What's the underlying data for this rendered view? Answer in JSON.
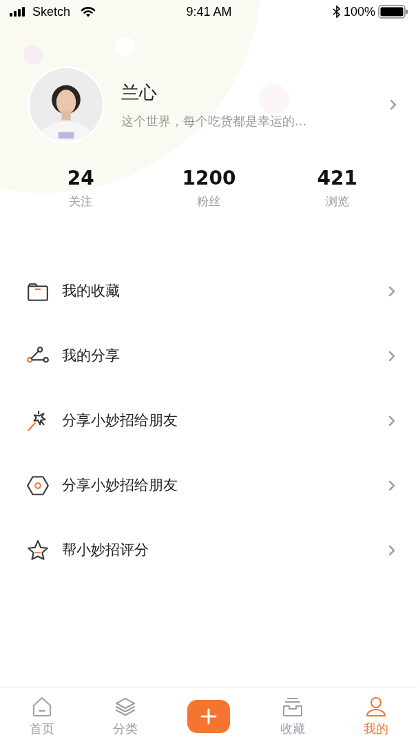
{
  "status_bar": {
    "carrier": "Sketch",
    "time": "9:41 AM",
    "battery": "100%"
  },
  "profile": {
    "name": "兰心",
    "bio": "这个世界，每个吃货都是幸运的..."
  },
  "stats": [
    {
      "value": "24",
      "label": "关注"
    },
    {
      "value": "1200",
      "label": "粉丝"
    },
    {
      "value": "421",
      "label": "浏览"
    }
  ],
  "menu": [
    {
      "kind": "folder",
      "label": "我的收藏"
    },
    {
      "kind": "share",
      "label": "我的分享"
    },
    {
      "kind": "wand",
      "label": "分享小妙招给朋友"
    },
    {
      "kind": "hexagon",
      "label": "分享小妙招给朋友"
    },
    {
      "kind": "star",
      "label": "帮小妙招评分"
    }
  ],
  "tab_bar": [
    {
      "kind": "home",
      "label": "首页",
      "selected": false
    },
    {
      "kind": "layers",
      "label": "分类",
      "selected": false
    },
    {
      "kind": "add",
      "selected": false
    },
    {
      "kind": "inbox",
      "label": "收藏",
      "selected": false
    },
    {
      "kind": "user",
      "label": "我的",
      "selected": true
    }
  ]
}
